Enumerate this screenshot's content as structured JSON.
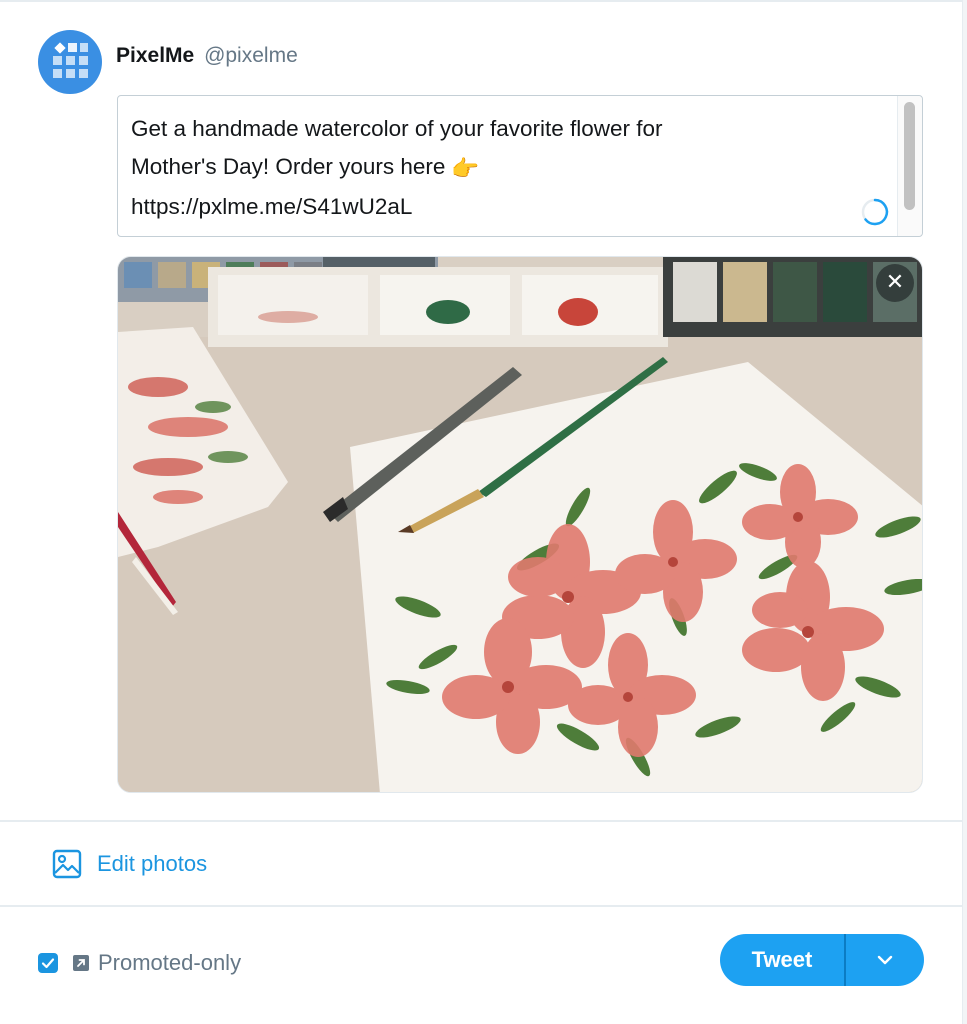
{
  "author": {
    "name": "PixelMe",
    "handle": "@pixelme"
  },
  "composer": {
    "lines": [
      "Get a handmade watercolor of your favorite flower for",
      "Mother's Day! Order yours here",
      "https://pxlme.me/S41wU2aL"
    ],
    "emoji": "👉"
  },
  "media": {
    "remove_glyph": "✕"
  },
  "edit_photos": {
    "label": "Edit photos"
  },
  "footer": {
    "promoted_checked": true,
    "promoted_label": "Promoted-only",
    "tweet_label": "Tweet"
  },
  "colors": {
    "accent": "#1da1f2",
    "link": "#1b95e0",
    "avatar": "#3a8fe3",
    "muted": "#657786"
  },
  "icons": [
    "pixelme-logo-icon",
    "loading-ring-icon",
    "close-icon",
    "image-icon",
    "checkmark-icon",
    "external-link-icon",
    "chevron-down-icon"
  ]
}
